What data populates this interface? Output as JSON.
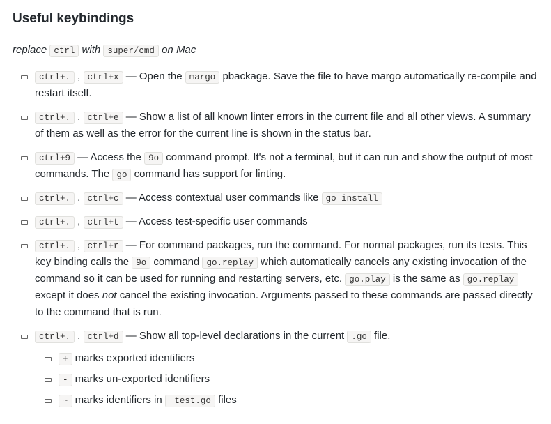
{
  "heading": "Useful keybindings",
  "intro": {
    "pre": "replace ",
    "kbd1": "ctrl",
    "mid": " with ",
    "kbd2": "super/cmd",
    "post": " on Mac"
  },
  "items": [
    {
      "k1": "ctrl+.",
      "sep1": " , ",
      "k2": "ctrl+x",
      "t1": " — Open the ",
      "c1": "margo",
      "t2": " pbackage. Save the file to have margo automatically re-compile and restart itself."
    },
    {
      "k1": "ctrl+.",
      "sep1": " , ",
      "k2": "ctrl+e",
      "t1": " — Show a list of all known linter errors in the current file and all other views. A summary of them as well as the error for the current line is shown in the status bar."
    },
    {
      "k1": "ctrl+9",
      "t1": " — Access the ",
      "c1": "9o",
      "t2": " command prompt. It's not a terminal, but it can run and show the output of most commands. The ",
      "c2": "go",
      "t3": " command has support for linting."
    },
    {
      "k1": "ctrl+.",
      "sep1": " , ",
      "k2": "ctrl+c",
      "t1": " — Access contextual user commands like ",
      "c1": "go install"
    },
    {
      "k1": "ctrl+.",
      "sep1": " , ",
      "k2": "ctrl+t",
      "t1": " — Access test-specific user commands"
    },
    {
      "k1": "ctrl+.",
      "sep1": " , ",
      "k2": "ctrl+r",
      "t1": " — For command packages, run the command. For normal packages, run its tests. This key binding calls the ",
      "c1": "9o",
      "t2": " command ",
      "c2": "go.replay",
      "t3": " which automatically cancels any existing invocation of the command so it can be used for running and restarting servers, etc. ",
      "c3": "go.play",
      "t4": " is the same as ",
      "c4": "go.replay",
      "t5": " except it does ",
      "em": "not",
      "t6": " cancel the existing invocation. Arguments passed to these commands are passed directly to the command that is run."
    },
    {
      "k1": "ctrl+.",
      "sep1": " , ",
      "k2": "ctrl+d",
      "t1": " — Show all top-level declarations in the current ",
      "c1": ".go",
      "t2": " file.",
      "sub": [
        {
          "c": "+",
          "t": " marks exported identifiers"
        },
        {
          "c": "-",
          "t": " marks un-exported identifiers"
        },
        {
          "c": "~",
          "t1": " marks identifiers in ",
          "c2": "_test.go",
          "t2": " files"
        }
      ]
    }
  ]
}
